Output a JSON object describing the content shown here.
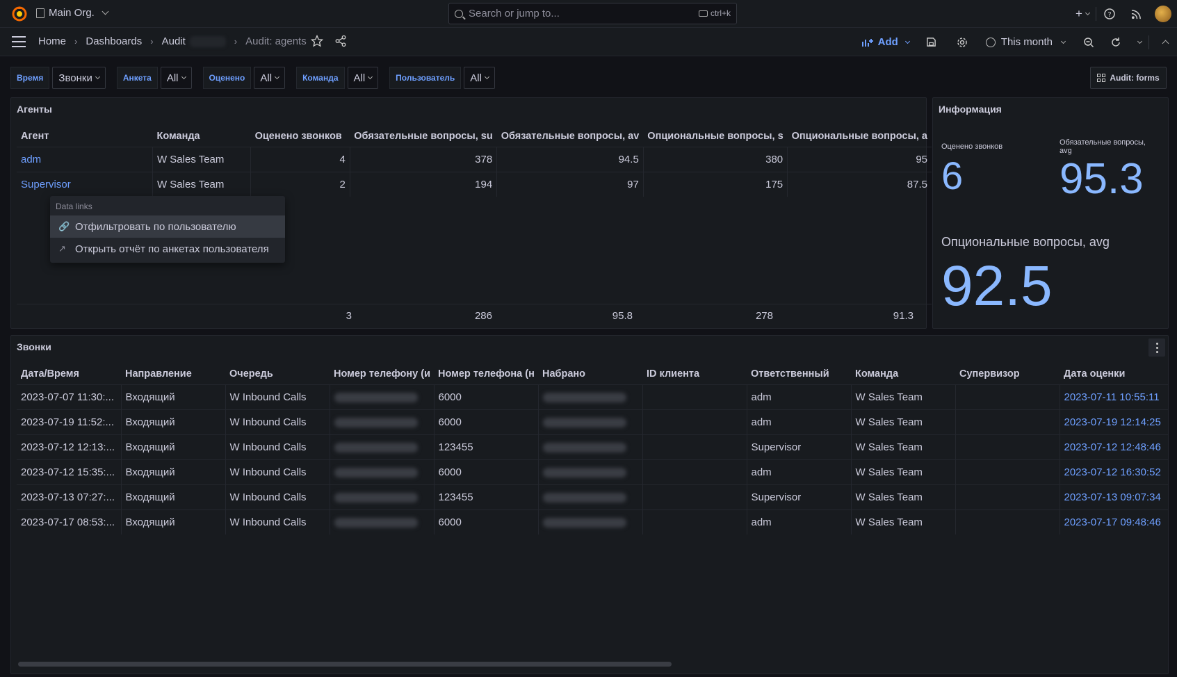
{
  "topbar": {
    "org": "Main Org.",
    "search_placeholder": "Search or jump to...",
    "shortcut": "ctrl+k"
  },
  "breadcrumbs": {
    "home": "Home",
    "dashboards": "Dashboards",
    "folder": "Audit",
    "current": "Audit: agents"
  },
  "toolbar": {
    "add_label": "Add",
    "time_range": "This month"
  },
  "variables": [
    {
      "label": "Время",
      "value": "Звонки"
    },
    {
      "label": "Анкета",
      "value": "All"
    },
    {
      "label": "Оценено",
      "value": "All"
    },
    {
      "label": "Команда",
      "value": "All"
    },
    {
      "label": "Пользователь",
      "value": "All"
    }
  ],
  "dashboard_link": "Audit: forms",
  "agents_panel": {
    "title": "Агенты",
    "columns": [
      "Агент",
      "Команда",
      "Оценено звонков",
      "Обязательные вопросы, su",
      "Обязательные вопросы, av",
      "Опциональные вопросы, s",
      "Опциональные вопросы, a"
    ],
    "rows": [
      [
        "adm",
        "W Sales Team",
        "4",
        "378",
        "94.5",
        "380",
        "95"
      ],
      [
        "Supervisor",
        "W Sales Team",
        "2",
        "194",
        "97",
        "175",
        "87.5"
      ]
    ],
    "footer": [
      "3",
      "286",
      "95.8",
      "278",
      "91.3"
    ]
  },
  "data_links": {
    "header": "Data links",
    "items": [
      "Отфильтровать по пользователю",
      "Открыть отчёт по анкетах пользователя"
    ]
  },
  "info_panel": {
    "title": "Информация",
    "stat1_label": "Оценено звонков",
    "stat1_value": "6",
    "stat2_label": "Обязательные вопросы, avg",
    "stat2_value": "95.3",
    "stat3_label": "Опциональные вопросы, avg",
    "stat3_value": "92.5"
  },
  "calls_panel": {
    "title": "Звонки",
    "columns": [
      "Дата/Время",
      "Направление",
      "Очередь",
      "Номер телефону (и",
      "Номер телефона (н",
      "Набрано",
      "ID клиента",
      "Ответственный",
      "Команда",
      "Супервизор",
      "Дата оценки"
    ],
    "rows": [
      [
        "2023-07-07 11:30:...",
        "Входящий",
        "W Inbound Calls",
        "",
        "6000",
        "",
        "",
        "adm",
        "W Sales Team",
        "",
        "2023-07-11 10:55:11"
      ],
      [
        "2023-07-19 11:52:...",
        "Входящий",
        "W Inbound Calls",
        "",
        "6000",
        "",
        "",
        "adm",
        "W Sales Team",
        "",
        "2023-07-19 12:14:25"
      ],
      [
        "2023-07-12 12:13:...",
        "Входящий",
        "W Inbound Calls",
        "",
        "123455",
        "",
        "",
        "Supervisor",
        "W Sales Team",
        "",
        "2023-07-12 12:48:46"
      ],
      [
        "2023-07-12 15:35:...",
        "Входящий",
        "W Inbound Calls",
        "",
        "6000",
        "",
        "",
        "adm",
        "W Sales Team",
        "",
        "2023-07-12 16:30:52"
      ],
      [
        "2023-07-13 07:27:...",
        "Входящий",
        "W Inbound Calls",
        "",
        "123455",
        "",
        "",
        "Supervisor",
        "W Sales Team",
        "",
        "2023-07-13 09:07:34"
      ],
      [
        "2023-07-17 08:53:...",
        "Входящий",
        "W Inbound Calls",
        "",
        "6000",
        "",
        "",
        "adm",
        "W Sales Team",
        "",
        "2023-07-17 09:48:46"
      ]
    ]
  },
  "colors": {
    "accent": "#6e9fff",
    "stat": "#8ab8ff",
    "background": "#111217",
    "panel": "#181b1f"
  }
}
